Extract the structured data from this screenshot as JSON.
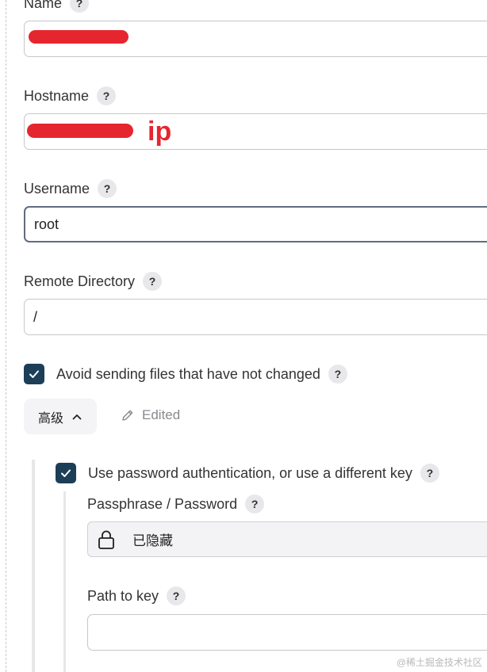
{
  "fields": {
    "name": {
      "label": "Name",
      "value": ""
    },
    "hostname": {
      "label": "Hostname",
      "value": "",
      "annotation": "ip"
    },
    "username": {
      "label": "Username",
      "value": "root"
    },
    "remote_directory": {
      "label": "Remote Directory",
      "value": "/"
    },
    "avoid_sending": {
      "label": "Avoid sending files that have not changed",
      "checked": true
    },
    "advanced": {
      "label": "高级",
      "edited_label": "Edited"
    },
    "use_password": {
      "label": "Use password authentication, or use a different key",
      "checked": true
    },
    "passphrase": {
      "label": "Passphrase / Password",
      "value": "已隐藏"
    },
    "path_to_key": {
      "label": "Path to key",
      "value": ""
    }
  },
  "help_symbol": "?",
  "watermark": "@稀土掘金技术社区",
  "colors": {
    "checkbox": "#1d3e57",
    "redaction": "#e5262f",
    "help_bg": "#e8e8eb"
  },
  "icons": [
    "help-icon",
    "check-icon",
    "chevron-up-icon",
    "pencil-icon",
    "lock-icon"
  ]
}
